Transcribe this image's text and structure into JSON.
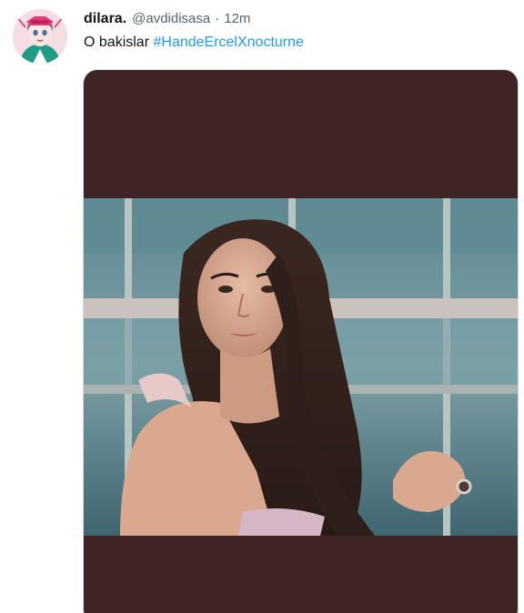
{
  "tweet": {
    "display_name": "dilara.",
    "handle": "@avdidisasa",
    "separator": "·",
    "timestamp": "12m",
    "text": "O bakislar",
    "hashtag": "#HandeErcelXnocturne"
  },
  "icons": {
    "avatar": "avatar-illustration",
    "media": "video-still"
  },
  "colors": {
    "link": "#1d9bf0",
    "text": "#0f1419",
    "secondary": "#536471",
    "media_letterbox": "#3e2524"
  }
}
